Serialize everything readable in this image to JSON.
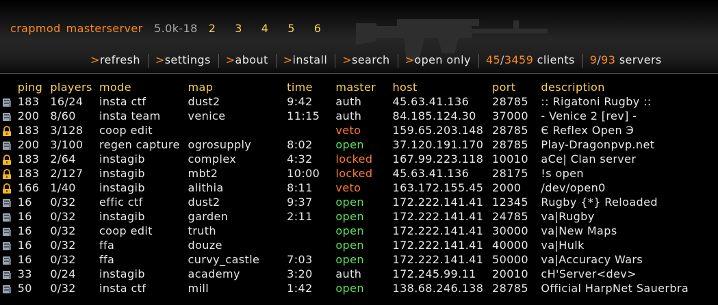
{
  "header": {
    "brand1": "crapmod",
    "brand2": "masterserver",
    "version": "5.0k-18",
    "page_tabs": [
      "2",
      "3",
      "4",
      "5",
      "6"
    ]
  },
  "menu": {
    "items": [
      ">refresh",
      ">settings",
      ">about",
      ">install",
      ">search",
      ">open only"
    ],
    "clients_online": "45",
    "clients_total": "3459",
    "clients_label": "clients",
    "servers_online": "9",
    "servers_total": "93",
    "servers_label": "servers"
  },
  "columns": {
    "ping": "ping",
    "players": "players",
    "mode": "mode",
    "map": "map",
    "time": "time",
    "master": "master",
    "host": "host",
    "port": "port",
    "description": "description"
  },
  "colors": {
    "accent": "#ff8a1c",
    "header": "#ffd34d",
    "open": "#5fe05f",
    "locked": "#ff7a2e"
  },
  "servers": [
    {
      "icon": "server-icon",
      "ping": "183",
      "players": "16/24",
      "mode": "insta ctf",
      "map": "dust2",
      "time": "9:42",
      "master": "auth",
      "host": "45.63.41.136",
      "port": "28785",
      "description": ":: Rigatoni Rugby ::"
    },
    {
      "icon": "server-icon",
      "ping": "200",
      "players": "8/60",
      "mode": "insta team",
      "map": "venice",
      "time": "11:15",
      "master": "auth",
      "host": "84.185.124.30",
      "port": "37000",
      "description": "- Venice 2 [rev] -"
    },
    {
      "icon": "lock-icon",
      "ping": "183",
      "players": "3/128",
      "mode": "coop edit",
      "map": "",
      "time": "",
      "master": "veto",
      "host": "159.65.203.148",
      "port": "28785",
      "description": "Є Reflex Open Э"
    },
    {
      "icon": "server-icon",
      "ping": "200",
      "players": "3/100",
      "mode": "regen capture",
      "map": "ogrosupply",
      "time": "8:02",
      "master": "open",
      "host": "37.120.191.170",
      "port": "28785",
      "description": "Play-Dragonpvp.net"
    },
    {
      "icon": "lock-icon",
      "ping": "183",
      "players": "2/64",
      "mode": "instagib",
      "map": "complex",
      "time": "4:32",
      "master": "locked",
      "host": "167.99.223.118",
      "port": "10010",
      "description": "aCe| Clan server"
    },
    {
      "icon": "lock-icon",
      "ping": "183",
      "players": "2/127",
      "mode": "instagib",
      "map": "mbt2",
      "time": "10:00",
      "master": "locked",
      "host": "45.63.41.136",
      "port": "28175",
      "description": "!s open"
    },
    {
      "icon": "lock-icon",
      "ping": "166",
      "players": "1/40",
      "mode": "instagib",
      "map": "alithia",
      "time": "8:11",
      "master": "veto",
      "host": "163.172.155.45",
      "port": "2000",
      "description": "/dev/open0"
    },
    {
      "icon": "server-icon",
      "ping": "16",
      "players": "0/32",
      "mode": "effic ctf",
      "map": "dust2",
      "time": "9:37",
      "master": "open",
      "host": "172.222.141.41",
      "port": "12345",
      "description": "Rugby {*} Reloaded"
    },
    {
      "icon": "server-icon",
      "ping": "16",
      "players": "0/32",
      "mode": "instagib",
      "map": "garden",
      "time": "2:11",
      "master": "open",
      "host": "172.222.141.41",
      "port": "24785",
      "description": "va|Rugby"
    },
    {
      "icon": "server-icon",
      "ping": "16",
      "players": "0/32",
      "mode": "coop edit",
      "map": "truth",
      "time": "",
      "master": "open",
      "host": "172.222.141.41",
      "port": "30000",
      "description": "va|New Maps"
    },
    {
      "icon": "server-icon",
      "ping": "16",
      "players": "0/32",
      "mode": "ffa",
      "map": "douze",
      "time": "",
      "master": "open",
      "host": "172.222.141.41",
      "port": "40000",
      "description": "va|Hulk"
    },
    {
      "icon": "server-icon",
      "ping": "16",
      "players": "0/32",
      "mode": "ffa",
      "map": "curvy_castle",
      "time": "7:03",
      "master": "open",
      "host": "172.222.141.41",
      "port": "50000",
      "description": "va|Accuracy Wars"
    },
    {
      "icon": "server-icon",
      "ping": "33",
      "players": "0/24",
      "mode": "instagib",
      "map": "academy",
      "time": "3:20",
      "master": "auth",
      "host": "172.245.99.11",
      "port": "20010",
      "description": "cH'Server<dev>"
    },
    {
      "icon": "server-icon",
      "ping": "50",
      "players": "0/32",
      "mode": "insta ctf",
      "map": "mill",
      "time": "1:42",
      "master": "open",
      "host": "138.68.246.138",
      "port": "28785",
      "description": "Official HarpNet Sauerbra"
    }
  ]
}
